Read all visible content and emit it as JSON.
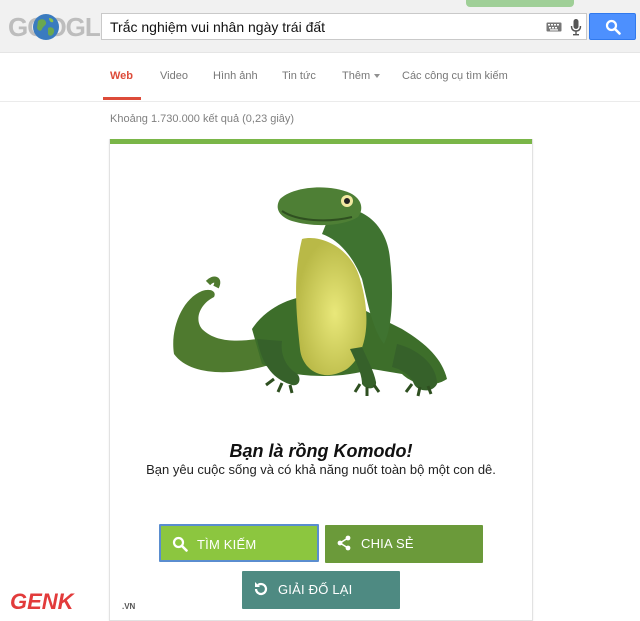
{
  "logo": {
    "text": "GOOGLE",
    "alt_text": "GOOGLE"
  },
  "search": {
    "query": "Trắc nghiệm vui nhân ngày trái đất"
  },
  "tabs": [
    {
      "label": "Web",
      "active": true
    },
    {
      "label": "Video"
    },
    {
      "label": "Hình ảnh"
    },
    {
      "label": "Tin tức"
    },
    {
      "label": "Thêm"
    },
    {
      "label": "Các công cụ tìm kiếm"
    }
  ],
  "results": {
    "stats": "Khoảng 1.730.000 kết quả (0,23 giây)"
  },
  "quiz": {
    "title": "Bạn là rồng Komodo!",
    "description": "Bạn yêu cuộc sống và có khả năng nuốt toàn bộ một con dê.",
    "buttons": {
      "search": "TÌM KIẾM",
      "share": "CHIA SẺ",
      "retry": "GIẢI ĐỐ LẠI"
    }
  },
  "watermark": {
    "text": "GENK",
    "suffix": ".VN"
  },
  "colors": {
    "accent_red": "#dd4b39",
    "search_blue": "#4d90fe",
    "card_green": "#7ab648",
    "btn_search": "#8cc63f",
    "btn_share": "#6b9a3a",
    "btn_retry": "#4e8a82"
  }
}
